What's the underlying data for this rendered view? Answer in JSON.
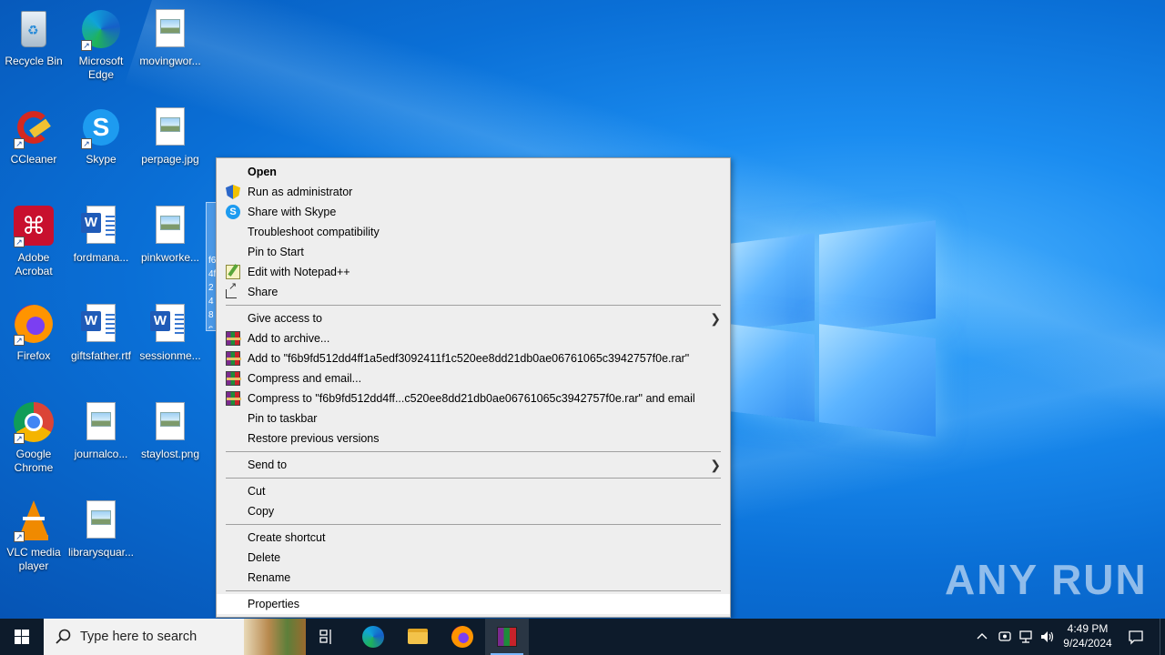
{
  "desktop": {
    "icons": [
      {
        "label": "Recycle Bin"
      },
      {
        "label": "Microsoft Edge"
      },
      {
        "label": "movingwor..."
      },
      {
        "label": "CCleaner"
      },
      {
        "label": "Skype"
      },
      {
        "label": "perpage.jpg"
      },
      {
        "label": "Adobe Acrobat"
      },
      {
        "label": "fordmana..."
      },
      {
        "label": "pinkworke..."
      },
      {
        "label": "Firefox"
      },
      {
        "label": "giftsfather.rtf"
      },
      {
        "label": "sessionme..."
      },
      {
        "label": "Google Chrome"
      },
      {
        "label": "journalco..."
      },
      {
        "label": "staylost.png"
      },
      {
        "label": "VLC media player"
      },
      {
        "label": "librarysquar..."
      }
    ],
    "selected_file_fragment": "f6 4f 24 8c 67 2"
  },
  "context_menu": {
    "items": [
      {
        "label": "Open",
        "icon": ""
      },
      {
        "label": "Run as administrator",
        "icon": "uac-shield-icon"
      },
      {
        "label": "Share with Skype",
        "icon": "skype-icon"
      },
      {
        "label": "Troubleshoot compatibility",
        "icon": ""
      },
      {
        "label": "Pin to Start",
        "icon": ""
      },
      {
        "label": "Edit with Notepad++",
        "icon": "notepadpp-icon"
      },
      {
        "label": "Share",
        "icon": "share-icon"
      },
      {
        "label": "Give access to",
        "icon": "",
        "submenu": true
      },
      {
        "label": "Add to archive...",
        "icon": "winrar-icon"
      },
      {
        "label": "Add to \"f6b9fd512dd4ff1a5edf3092411f1c520ee8dd21db0ae06761065c3942757f0e.rar\"",
        "icon": "winrar-icon"
      },
      {
        "label": "Compress and email...",
        "icon": "winrar-icon"
      },
      {
        "label": "Compress to \"f6b9fd512dd4ff...c520ee8dd21db0ae06761065c3942757f0e.rar\" and email",
        "icon": "winrar-icon"
      },
      {
        "label": "Pin to taskbar",
        "icon": ""
      },
      {
        "label": "Restore previous versions",
        "icon": ""
      },
      {
        "label": "Send to",
        "icon": "",
        "submenu": true
      },
      {
        "label": "Cut",
        "icon": ""
      },
      {
        "label": "Copy",
        "icon": ""
      },
      {
        "label": "Create shortcut",
        "icon": ""
      },
      {
        "label": "Delete",
        "icon": ""
      },
      {
        "label": "Rename",
        "icon": ""
      },
      {
        "label": "Properties",
        "icon": ""
      }
    ]
  },
  "watermark": {
    "text": "ANY RUN"
  },
  "taskbar": {
    "search_placeholder": "Type here to search",
    "apps": [
      "task-view-icon",
      "edge-icon",
      "file-explorer-icon",
      "firefox-icon",
      "winrar-icon"
    ],
    "clock": {
      "time": "4:49 PM",
      "date": "9/24/2024"
    }
  },
  "colors": {
    "accent": "#0a6fd6",
    "taskbar": "#0d1b2b",
    "menu_bg": "#eeeeee"
  }
}
